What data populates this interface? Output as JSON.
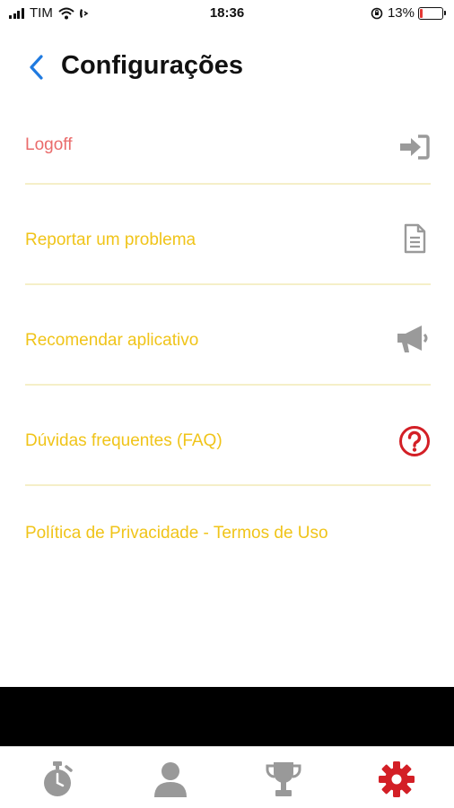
{
  "status_bar": {
    "carrier": "TIM",
    "time": "18:36",
    "battery": "13%"
  },
  "header": {
    "title": "Configurações"
  },
  "menu": {
    "items": [
      {
        "label": "Logoff",
        "icon": "logout-icon",
        "color": "#ea6b6b"
      },
      {
        "label": "Reportar um problema",
        "icon": "document-icon",
        "color": "#f0c419"
      },
      {
        "label": "Recomendar aplicativo",
        "icon": "megaphone-icon",
        "color": "#f0c419"
      },
      {
        "label": "Dúvidas frequentes (FAQ)",
        "icon": "question-circle-icon",
        "color": "#f0c419"
      },
      {
        "label": "Política de Privacidade - Termos de Uso",
        "color": "#f0c419"
      }
    ]
  },
  "tab_bar": {
    "tabs": [
      {
        "icon": "stopwatch-icon",
        "active": false
      },
      {
        "icon": "user-icon",
        "active": false
      },
      {
        "icon": "trophy-icon",
        "active": false
      },
      {
        "icon": "gear-icon",
        "active": true
      }
    ],
    "active_color": "#d31f26",
    "inactive_color": "#999999"
  },
  "colors": {
    "accent": "#f0c419",
    "danger": "#ea6b6b",
    "back_arrow": "#1f7ae0"
  }
}
